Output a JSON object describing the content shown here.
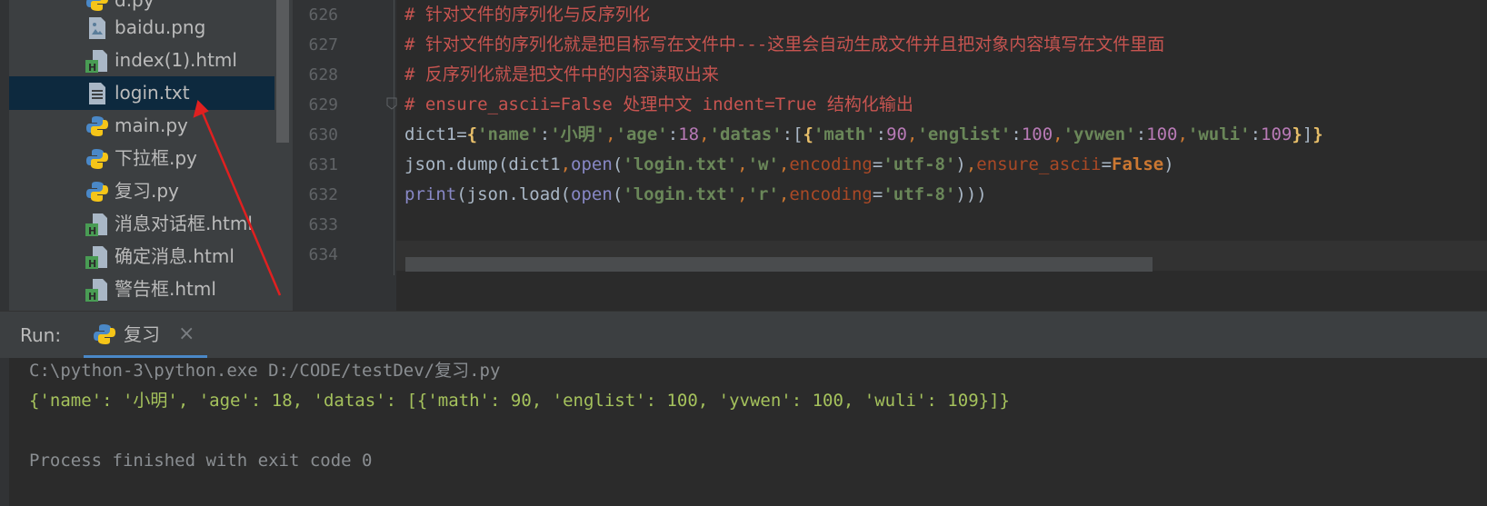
{
  "project_tree": {
    "partial_top": "d.py",
    "files": [
      {
        "name": "baidu.png",
        "icon": "image-file-icon"
      },
      {
        "name": "index(1).html",
        "icon": "html-file-icon"
      },
      {
        "name": "login.txt",
        "icon": "text-file-icon",
        "selected": true
      },
      {
        "name": "main.py",
        "icon": "python-file-icon"
      },
      {
        "name": "下拉框.py",
        "icon": "python-file-icon"
      },
      {
        "name": "复习.py",
        "icon": "python-file-icon"
      },
      {
        "name": "消息对话框.html",
        "icon": "html-file-icon"
      },
      {
        "name": "确定消息.html",
        "icon": "html-file-icon"
      },
      {
        "name": "警告框.html",
        "icon": "html-file-icon"
      }
    ]
  },
  "editor": {
    "line_numbers": [
      "626",
      "627",
      "628",
      "629",
      "630",
      "631",
      "632",
      "633",
      "634"
    ],
    "comments": [
      "# 针对文件的序列化与反序列化",
      "# 针对文件的序列化就是把目标写在文件中---这里会自动生成文件并且把对象内容填写在文件里面",
      "# 反序列化就是把文件中的内容读取出来",
      "# ensure_ascii=False 处理中文 indent=True 结构化输出"
    ],
    "code_630": {
      "var": "dict1",
      "eq": "=",
      "open_brace": "{",
      "k_name": "'name'",
      "colon": ":",
      "v_name": "'小明'",
      "comma": ",",
      "k_age": "'age'",
      "v_age": "18",
      "k_datas": "'datas'",
      "open_list": "[",
      "k_math": "'math'",
      "v_math": "90",
      "k_englist": "'englist'",
      "v_englist": "100",
      "k_yvwen": "'yvwen'",
      "v_yvwen": "100",
      "k_wuli": "'wuli'",
      "v_wuli": "109",
      "close_brace": "}",
      "close_list": "]"
    },
    "code_631": {
      "call": "json.dump(dict1",
      "comma": ",",
      "open": "open",
      "paren": "(",
      "file": "'login.txt'",
      "mode": "'w'",
      "enc_kw": "encoding",
      "eq": "=",
      "enc_val": "'utf-8'",
      "close": ")",
      "ascii_kw": "ensure_ascii",
      "false": "False"
    },
    "code_632": {
      "print": "print",
      "call": "(json.load(",
      "open": "open",
      "paren": "(",
      "file": "'login.txt'",
      "comma": ",",
      "mode": "'r'",
      "enc_kw": "encoding",
      "eq": "=",
      "enc_val": "'utf-8'",
      "close": ")))"
    }
  },
  "run_panel": {
    "label": "Run:",
    "tab_label": "复习",
    "tab_close": "×",
    "output": [
      "C:\\python-3\\python.exe D:/CODE/testDev/复习.py",
      "{'name': '小明', 'age': 18, 'datas': [{'math': 90, 'englist': 100, 'yvwen': 100, 'wuli': 109}]}",
      "",
      "Process finished with exit code 0"
    ]
  },
  "colors": {
    "background": "#2b2b2b",
    "comment": "#c75450",
    "string": "#6a8759",
    "number": "#b87ab6",
    "keyword": "#cc7832",
    "selection": "#0d293e",
    "annotation_arrow": "#e02020"
  }
}
